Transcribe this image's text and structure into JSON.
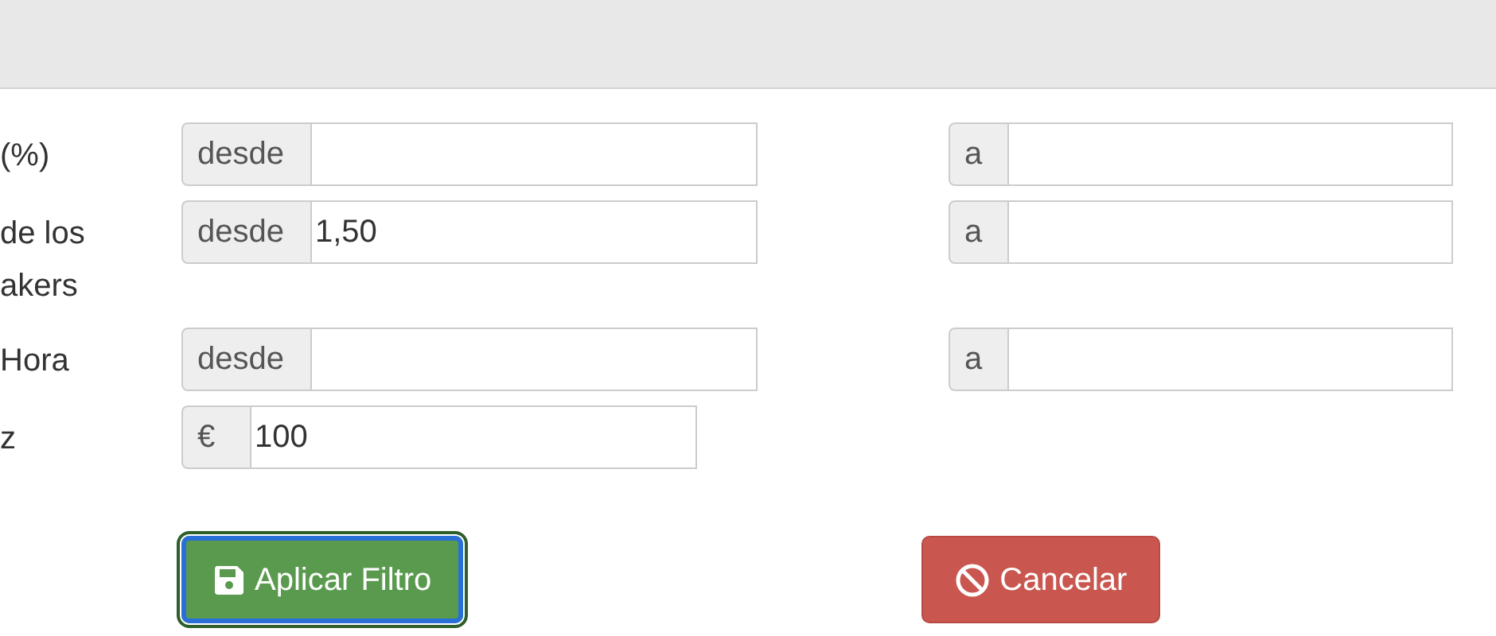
{
  "rows": [
    {
      "kind": "range",
      "label_lines": [
        "(%)"
      ],
      "from": {
        "addon": "desde"
      },
      "to": {
        "addon": "a"
      }
    },
    {
      "kind": "range",
      "label_lines": [
        "de los",
        "akers"
      ],
      "from": {
        "addon": "desde",
        "value": "1,50"
      },
      "to": {
        "addon": "a"
      }
    },
    {
      "kind": "range",
      "label_lines": [
        "Hora"
      ],
      "from": {
        "addon": "desde"
      },
      "to": {
        "addon": "a"
      }
    },
    {
      "kind": "single",
      "label_lines": [
        "z"
      ],
      "field": {
        "addon": "€",
        "value": "100"
      }
    }
  ],
  "buttons": [
    {
      "kind": "apply",
      "label": "Aplicar Filtro",
      "focused": true
    },
    {
      "kind": "cancel",
      "label": "Cancelar",
      "focused": false
    }
  ]
}
